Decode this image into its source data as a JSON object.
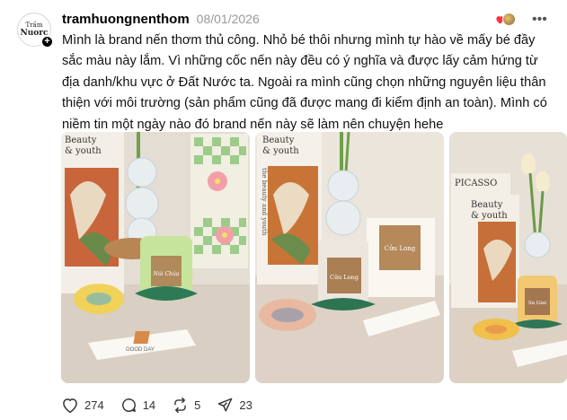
{
  "post": {
    "author": {
      "username": "tramhuongnenthom",
      "avatar_text_top": "Trầm",
      "avatar_text_bottom": "Nuorc",
      "follow_icon": "plus-icon"
    },
    "timestamp": "08/01/2026",
    "text": "Mình là brand nến thơm thủ công. Nhỏ bé thôi nhưng mình tự hào về mấy bé đầy sắc màu này lắm. Vì những cốc nến này đều có ý nghĩa và được lấy cảm hứng từ địa danh/khu vực ở Đất Nước ta. Ngoài ra mình cũng chọn những nguyên liệu thân thiện với môi trường (sản phẩm cũng đã được mang đi kiểm định an toàn). Mình có niềm tin một ngày nào đó brand nến này sẽ làm nên chuyện hehe",
    "images": [
      {
        "candle_label": "Núi Chúa",
        "box_text": "GOOD DAY",
        "book_title": "Beauty & youth"
      },
      {
        "candle_label": "Cửu Long",
        "box_label": "Cửu Long",
        "book_title": "Beauty & youth",
        "book_spine": "the beauty and youth"
      },
      {
        "candle_label": "Sa Giai",
        "book_title": "Beauty & youth",
        "book_top": "PICASSO"
      }
    ],
    "stats": {
      "likes": "274",
      "replies": "14",
      "reposts": "5",
      "shares": "23"
    }
  },
  "icons": {
    "like": "heart-outline-icon",
    "reply": "comment-bubble-icon",
    "repost": "repost-arrows-icon",
    "share": "paper-plane-icon",
    "more": "ellipsis-icon",
    "reaction": "heart-reaction-icon"
  },
  "colors": {
    "reaction_heart": "#ff3040",
    "muted": "#999999",
    "text": "#111111"
  }
}
